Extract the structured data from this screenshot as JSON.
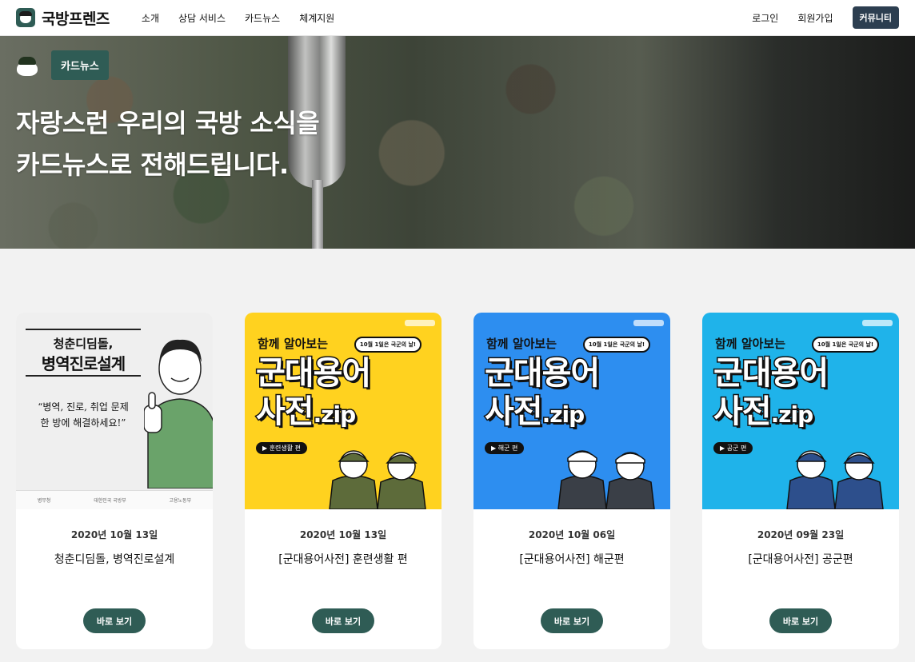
{
  "nav": {
    "logo": "국방프렌즈",
    "menu": [
      "소개",
      "상담 서비스",
      "카드뉴스",
      "체계지원"
    ],
    "login": "로그인",
    "signup": "회원가입",
    "community": "커뮤니티"
  },
  "hero": {
    "tag": "카드뉴스",
    "title_line1": "자랑스런 우리의 국방 소식을",
    "title_line2": "카드뉴스로 전해드립니다."
  },
  "cards": [
    {
      "date": "2020년 10월 13일",
      "title": "청춘디딤돌, 병역진로설계",
      "button": "바로 보기",
      "thumb": {
        "line1": "청춘디딤돌,",
        "line2": "병역진로설계",
        "quote1": "“병역, 진로, 취업 문제",
        "quote2": "한 방에 해결하세요!”",
        "footer": [
          "병무청",
          "대한민국 국방부",
          "고용노동부"
        ]
      }
    },
    {
      "date": "2020년 10월 13일",
      "title": "[군대용어사전] 훈련생활 편",
      "button": "바로 보기",
      "thumb": {
        "heading": "함께 알아보는",
        "bubble": "10월 1일은 국군의 날!",
        "big1": "군대용어",
        "big2": "사전",
        "zip": ".zip",
        "chip": "▶ 훈련생활 편",
        "bg": "#ffd21f",
        "uniform": "#5d6b3a"
      }
    },
    {
      "date": "2020년 10월 06일",
      "title": "[군대용어사전] 해군편",
      "button": "바로 보기",
      "thumb": {
        "heading": "함께 알아보는",
        "bubble": "10월 1일은 국군의 날!",
        "big1": "군대용어",
        "big2": "사전",
        "zip": ".zip",
        "chip": "▶ 해군 편",
        "bg": "#2d8ef0",
        "uniform": "#3a3f47"
      }
    },
    {
      "date": "2020년 09월 23일",
      "title": "[군대용어사전] 공군편",
      "button": "바로 보기",
      "thumb": {
        "heading": "함께 알아보는",
        "bubble": "10월 1일은 국군의 날!",
        "big1": "군대용어",
        "big2": "사전",
        "zip": ".zip",
        "chip": "▶ 공군 편",
        "bg": "#1fb3ea",
        "uniform": "#2d4f8c"
      }
    }
  ]
}
